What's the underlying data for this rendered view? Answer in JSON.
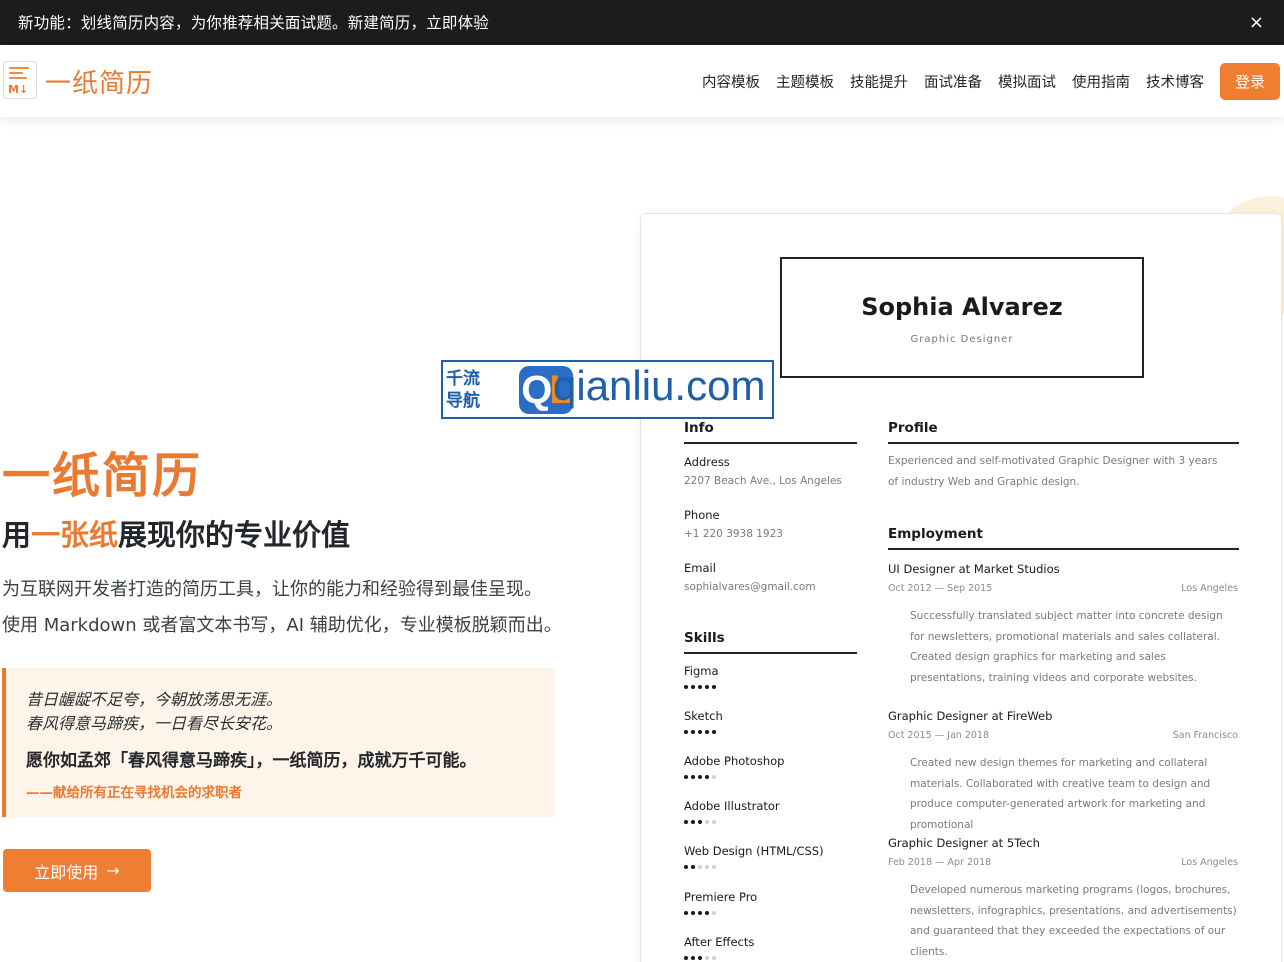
{
  "announcement": {
    "text": "新功能：划线简历内容，为你推荐相关面试题。新建简历，立即体验",
    "close": "×"
  },
  "header": {
    "logo_badge": "M↓",
    "logo_text": "一纸简历",
    "nav": [
      "内容模板",
      "主题模板",
      "技能提升",
      "面试准备",
      "模拟面试",
      "使用指南",
      "技术博客"
    ],
    "login": "登录"
  },
  "hero": {
    "title": "一纸简历",
    "subtitle_pre": "用",
    "subtitle_hl": "一张纸",
    "subtitle_post": "展现你的专业价值",
    "desc1": "为互联网开发者打造的简历工具，让你的能力和经验得到最佳呈现。",
    "desc2": "使用 Markdown 或者富文本书写，AI 辅助优化，专业模板脱颖而出。",
    "quote1": "昔日龌龊不足夸，今朝放荡思无涯。",
    "quote2": "春风得意马蹄疾，一日看尽长安花。",
    "quote_main": "愿你如孟郊「春风得意马蹄疾」，一纸简历，成就万千可能。",
    "quote_sign": "——献给所有正在寻找机会的求职者",
    "cta": "立即使用",
    "cta_arrow": "→"
  },
  "resume": {
    "name": "Sophia Alvarez",
    "role": "Graphic Designer",
    "info_heading": "Info",
    "info": [
      {
        "label": "Address",
        "value": "2207 Beach Ave., Los Angeles"
      },
      {
        "label": "Phone",
        "value": "+1 220 3938 1923"
      },
      {
        "label": "Email",
        "value": "sophialvares@gmail.com"
      }
    ],
    "skills_heading": "Skills",
    "skills": [
      {
        "name": "Figma",
        "level": 5
      },
      {
        "name": "Sketch",
        "level": 5
      },
      {
        "name": "Adobe Photoshop",
        "level": 4
      },
      {
        "name": "Adobe Illustrator",
        "level": 3
      },
      {
        "name": "Web Design (HTML/CSS)",
        "level": 2
      },
      {
        "name": "Premiere Pro",
        "level": 4
      },
      {
        "name": "After Effects",
        "level": 3
      }
    ],
    "profile_heading": "Profile",
    "profile": "Experienced and self-motivated Graphic Designer with 3 years of industry Web and Graphic design.",
    "employment_heading": "Employment",
    "jobs": [
      {
        "title": "UI Designer at Market Studios",
        "date": "Oct 2012 — Sep 2015",
        "location": "Los Angeles",
        "desc": "Successfully translated subject matter into concrete design for newsletters, promotional materials and sales collateral. Created design graphics for marketing and sales presentations, training videos and corporate websites."
      },
      {
        "title": "Graphic Designer at FireWeb",
        "date": "Oct 2015 — Jan 2018",
        "location": "San Francisco",
        "desc": "Created new design themes for marketing and collateral materials. Collaborated with creative team to design and produce computer-generated artwork for marketing and promotional"
      },
      {
        "title": "Graphic Designer at 5Tech",
        "date": "Feb 2018 — Apr 2018",
        "location": "Los Angeles",
        "desc": "Developed numerous marketing programs (logos, brochures, newsletters, infographics, presentations, and advertisements) and guaranteed that they exceeded the expectations of our clients."
      }
    ]
  },
  "watermark": {
    "cn": "千流导航",
    "logo": "QL",
    "domain": "qianliu.com"
  },
  "colors": {
    "accent": "#ef7d32",
    "dark_bar": "#1b1c1e",
    "quote_bg": "#fef4ea"
  }
}
